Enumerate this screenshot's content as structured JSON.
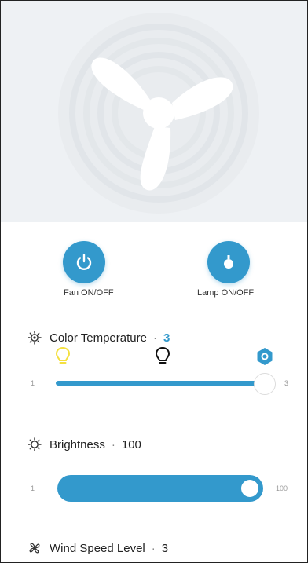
{
  "fan_buttons": {
    "fan_label": "Fan ON/OFF",
    "lamp_label": "Lamp ON/OFF"
  },
  "color_temperature": {
    "title": "Color Temperature",
    "separator": "·",
    "value": "3",
    "min_label": "1",
    "max_label": "3",
    "level_fraction": 1.0,
    "icons": [
      "warm-bulb-icon",
      "neutral-bulb-icon",
      "cool-hexagon-icon"
    ]
  },
  "brightness": {
    "title": "Brightness",
    "separator": "·",
    "value": "100",
    "min_label": "1",
    "max_label": "100",
    "level_fraction": 1.0
  },
  "wind_speed": {
    "title": "Wind Speed Level",
    "separator": "·",
    "value": "3"
  },
  "colors": {
    "accent": "#3399cc",
    "hero_bg": "#eef1f4",
    "warm_bulb": "#f4e040"
  }
}
